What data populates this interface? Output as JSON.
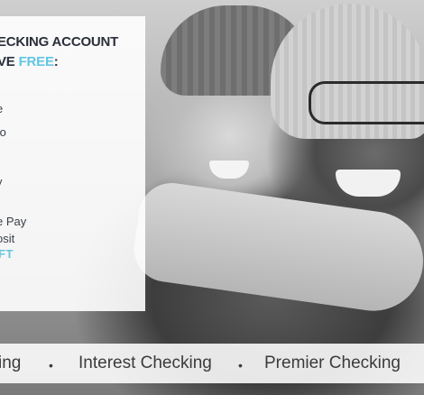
{
  "promo": {
    "headline_line1": "ECKING ACCOUNT",
    "headline_line2_prefix": "VE ",
    "headline_line2_accent": "FREE",
    "headline_line2_suffix": ":",
    "benefits": [
      "e",
      "to",
      "y",
      "e Pay",
      "osit"
    ],
    "link_label": "FT",
    "accent_color": "#62c6e3"
  },
  "ticker": {
    "items": [
      "ing",
      "Interest Checking",
      "Premier Checking"
    ],
    "separator": "•"
  }
}
